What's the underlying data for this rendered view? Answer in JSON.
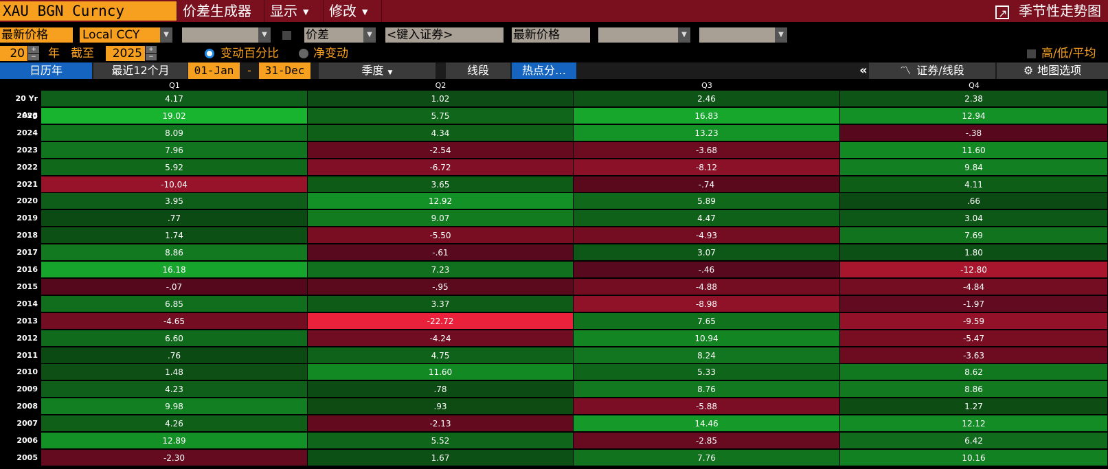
{
  "topbar": {
    "ticker": "XAU BGN Curncy",
    "menus": [
      "价差生成器",
      "显示",
      "修改"
    ],
    "seasonality": "季节性走势图"
  },
  "controls": {
    "field_left": "最新价格",
    "currency": "Local CCY",
    "spread_label": "价差",
    "security_placeholder": "<键入证券>",
    "field_right": "最新价格",
    "years": "20",
    "year_label": "年",
    "until_label": "截至",
    "until_year": "2025",
    "mode_pct": "变动百分比",
    "mode_net": "净变动",
    "hilo_label": "高/低/平均"
  },
  "tabs": {
    "calendar_year": "日历年",
    "last12": "最近12个月",
    "start": "01-Jan",
    "dash": "-",
    "end": "31-Dec",
    "quarter": "季度",
    "line": "线段",
    "heatmap": "热点分…",
    "collapse": "«",
    "sec_line": "证券/线段",
    "map_options": "地图选项"
  },
  "colors": {
    "accent_orange": "#f7a01f",
    "topbar_red": "#7a0f1e",
    "tab_blue": "#1565c0"
  },
  "table": {
    "columns": [
      "Q1",
      "Q2",
      "Q3",
      "Q4"
    ],
    "rows": [
      {
        "label": "20 Yr Avg",
        "values": [
          "4.17",
          "1.02",
          "2.46",
          "2.38"
        ]
      },
      {
        "label": "2025",
        "values": [
          "19.02",
          "5.75",
          "16.83",
          "12.94"
        ]
      },
      {
        "label": "2024",
        "values": [
          "8.09",
          "4.34",
          "13.23",
          "-.38"
        ]
      },
      {
        "label": "2023",
        "values": [
          "7.96",
          "-2.54",
          "-3.68",
          "11.60"
        ]
      },
      {
        "label": "2022",
        "values": [
          "5.92",
          "-6.72",
          "-8.12",
          "9.84"
        ]
      },
      {
        "label": "2021",
        "values": [
          "-10.04",
          "3.65",
          "-.74",
          "4.11"
        ]
      },
      {
        "label": "2020",
        "values": [
          "3.95",
          "12.92",
          "5.89",
          ".66"
        ]
      },
      {
        "label": "2019",
        "values": [
          ".77",
          "9.07",
          "4.47",
          "3.04"
        ]
      },
      {
        "label": "2018",
        "values": [
          "1.74",
          "-5.50",
          "-4.93",
          "7.69"
        ]
      },
      {
        "label": "2017",
        "values": [
          "8.86",
          "-.61",
          "3.07",
          "1.80"
        ]
      },
      {
        "label": "2016",
        "values": [
          "16.18",
          "7.23",
          "-.46",
          "-12.80"
        ]
      },
      {
        "label": "2015",
        "values": [
          "-.07",
          "-.95",
          "-4.88",
          "-4.84"
        ]
      },
      {
        "label": "2014",
        "values": [
          "6.85",
          "3.37",
          "-8.98",
          "-1.97"
        ]
      },
      {
        "label": "2013",
        "values": [
          "-4.65",
          "-22.72",
          "7.65",
          "-9.59"
        ]
      },
      {
        "label": "2012",
        "values": [
          "6.60",
          "-4.24",
          "10.94",
          "-5.47"
        ]
      },
      {
        "label": "2011",
        "values": [
          ".76",
          "4.75",
          "8.24",
          "-3.63"
        ]
      },
      {
        "label": "2010",
        "values": [
          "1.48",
          "11.60",
          "5.33",
          "8.62"
        ]
      },
      {
        "label": "2009",
        "values": [
          "4.23",
          ".78",
          "8.76",
          "8.86"
        ]
      },
      {
        "label": "2008",
        "values": [
          "9.98",
          ".93",
          "-5.88",
          "1.27"
        ]
      },
      {
        "label": "2007",
        "values": [
          "4.26",
          "-2.13",
          "14.46",
          "12.12"
        ]
      },
      {
        "label": "2006",
        "values": [
          "12.89",
          "5.52",
          "-2.85",
          "6.42"
        ]
      },
      {
        "label": "2005",
        "values": [
          "-2.30",
          "1.67",
          "7.76",
          "10.16"
        ]
      }
    ]
  }
}
